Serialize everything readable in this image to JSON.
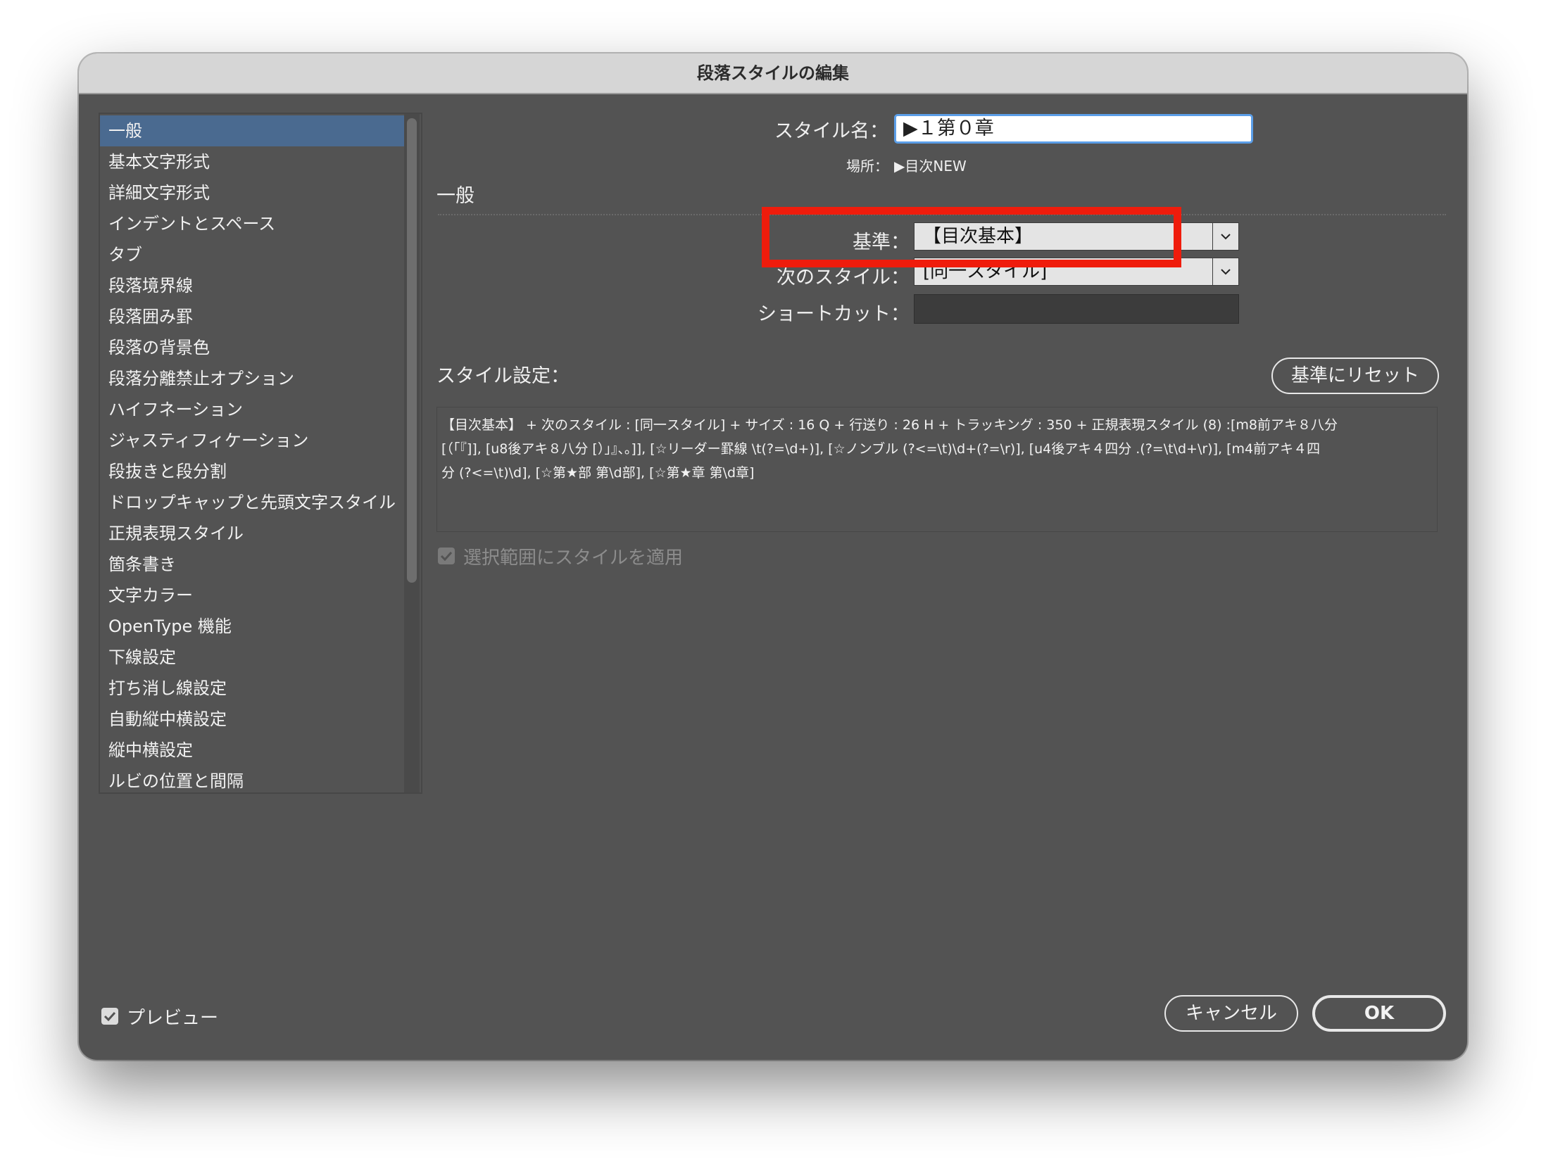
{
  "window": {
    "title": "段落スタイルの編集"
  },
  "sidebar": {
    "items": [
      {
        "label": "一般",
        "selected": true
      },
      {
        "label": "基本文字形式"
      },
      {
        "label": "詳細文字形式"
      },
      {
        "label": "インデントとスペース"
      },
      {
        "label": "タブ"
      },
      {
        "label": "段落境界線"
      },
      {
        "label": "段落囲み罫"
      },
      {
        "label": "段落の背景色"
      },
      {
        "label": "段落分離禁止オプション"
      },
      {
        "label": "ハイフネーション"
      },
      {
        "label": "ジャスティフィケーション"
      },
      {
        "label": "段抜きと段分割"
      },
      {
        "label": "ドロップキャップと先頭文字スタイル"
      },
      {
        "label": "正規表現スタイル"
      },
      {
        "label": "箇条書き"
      },
      {
        "label": "文字カラー"
      },
      {
        "label": "OpenType 機能"
      },
      {
        "label": "下線設定"
      },
      {
        "label": "打ち消し線設定"
      },
      {
        "label": "自動縦中横設定"
      },
      {
        "label": "縦中横設定"
      },
      {
        "label": "ルビの位置と間隔"
      }
    ]
  },
  "form": {
    "style_name_label": "スタイル名：",
    "style_name_value": "▶１第０章",
    "location_label": "場所：",
    "location_value": "▶目次NEW",
    "section_title": "一般",
    "based_on_label": "基準：",
    "based_on_value": "【目次基本】",
    "next_style_label": "次のスタイル：",
    "next_style_value": "[同一スタイル]",
    "shortcut_label": "ショートカット：",
    "shortcut_value": "",
    "style_settings_label": "スタイル設定：",
    "reset_button_label": "基準にリセット",
    "style_settings_lines": [
      "【目次基本】 + 次のスタイル : [同一スタイル] + サイズ : 16 Q + 行送り : 26 H + トラッキング : 350 + 正規表現スタイル (8) :[m8前アキ８八分",
      "[（「『]], [u8後アキ８八分 [）」』、。]], [☆リーダー罫線 \\t(?=\\d+)], [☆ノンブル (?<=\\t)\\d+(?=\\r)], [u4後アキ４四分 .(?=\\t\\d+\\r)], [m4前アキ４四",
      "分 (?<=\\t)\\d], [☆第★部 第\\d部], [☆第★章 第\\d章]"
    ],
    "apply_to_selection_label": "選択範囲にスタイルを適用",
    "apply_to_selection_checked": true
  },
  "footer": {
    "preview_label": "プレビュー",
    "preview_checked": true,
    "cancel_label": "キャンセル",
    "ok_label": "OK"
  },
  "colors": {
    "dialog_bg": "#535353",
    "selection": "#4a6a90",
    "highlight": "#ef1c0c",
    "input_focus": "#5b9ee8"
  }
}
